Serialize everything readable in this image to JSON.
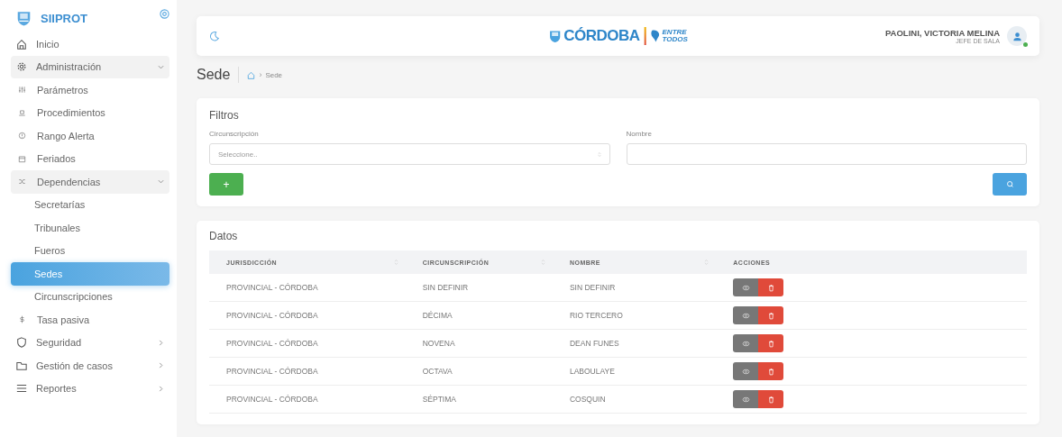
{
  "sidebar": {
    "brand": "SIIPROT",
    "items": [
      {
        "label": "Inicio",
        "selected": false
      },
      {
        "label": "Administración",
        "selected": false,
        "expanded": true,
        "children": [
          {
            "label": "Parámetros",
            "selected": false
          },
          {
            "label": "Procedimientos",
            "selected": false
          },
          {
            "label": "Rango Alerta",
            "selected": false
          },
          {
            "label": "Feriados",
            "selected": false
          },
          {
            "label": "Dependencias",
            "selected": false,
            "expanded": true,
            "children": [
              {
                "label": "Secretarías",
                "selected": false
              },
              {
                "label": "Tribunales",
                "selected": false
              },
              {
                "label": "Fueros",
                "selected": false
              },
              {
                "label": "Sedes",
                "selected": true
              },
              {
                "label": "Circunscripciones",
                "selected": false
              }
            ]
          },
          {
            "label": "Tasa pasiva",
            "selected": false
          }
        ]
      },
      {
        "label": "Seguridad",
        "selected": false,
        "expanded": false
      },
      {
        "label": "Gestión de casos",
        "selected": false,
        "expanded": false
      },
      {
        "label": "Reportes",
        "selected": false,
        "expanded": false
      }
    ]
  },
  "header": {
    "logo_main": "CÓRDOBA",
    "logo_side": [
      "ENTRE",
      "TODOS"
    ],
    "user_name": "PAOLINI, VICTORIA MELINA",
    "user_role": "JEFE DE SALA",
    "online": true
  },
  "page": {
    "title": "Sede",
    "separator": "›",
    "breadcrumb": "Sede"
  },
  "filters": {
    "title": "Filtros",
    "fields": [
      {
        "label": "Circunscripción",
        "kind": "select",
        "placeholder": "Seleccione.."
      },
      {
        "label": "Nombre",
        "kind": "text"
      }
    ],
    "add_button": "+"
  },
  "table": {
    "title": "Datos",
    "columns": [
      {
        "label": "JURISDICCIÓN",
        "sortable": true
      },
      {
        "label": "CIRCUNSCRIPCIÓN",
        "sortable": true
      },
      {
        "label": "NOMBRE",
        "sortable": true
      },
      {
        "label": "ACCIONES",
        "sortable": false
      }
    ],
    "rows": [
      [
        "PROVINCIAL - CÓRDOBA",
        "SIN DEFINIR",
        "SIN DEFINIR"
      ],
      [
        "PROVINCIAL - CÓRDOBA",
        "DÉCIMA",
        "RIO TERCERO"
      ],
      [
        "PROVINCIAL - CÓRDOBA",
        "NOVENA",
        "DEAN FUNES"
      ],
      [
        "PROVINCIAL - CÓRDOBA",
        "OCTAVA",
        "LABOULAYE"
      ],
      [
        "PROVINCIAL - CÓRDOBA",
        "SÉPTIMA",
        "COSQUIN"
      ]
    ]
  }
}
